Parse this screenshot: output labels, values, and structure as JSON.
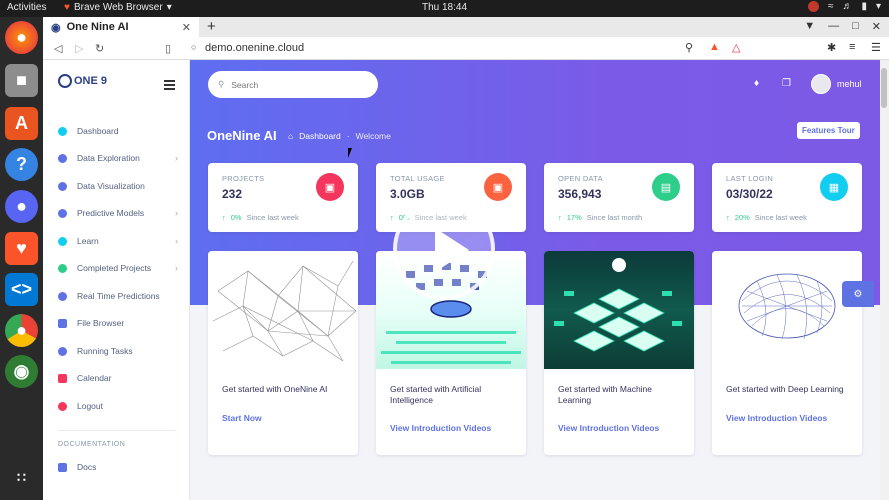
{
  "os": {
    "activities": "Activities",
    "app_name": "Brave Web Browser",
    "clock": "Thu 18:44"
  },
  "browser": {
    "tab_title": "One Nine AI",
    "url": "demo.onenine.cloud"
  },
  "logo": {
    "text": "ONE 9"
  },
  "sidebar": {
    "items": [
      {
        "label": "Dashboard",
        "color": "#11cdef",
        "chevron": false
      },
      {
        "label": "Data Exploration",
        "color": "#5e72e4",
        "chevron": true
      },
      {
        "label": "Data Visualization",
        "color": "#5e72e4",
        "chevron": false
      },
      {
        "label": "Predictive Models",
        "color": "#5e72e4",
        "chevron": true
      },
      {
        "label": "Learn",
        "color": "#11cdef",
        "chevron": true
      },
      {
        "label": "Completed Projects",
        "color": "#2dce89",
        "chevron": true
      },
      {
        "label": "Real Time Predictions",
        "color": "#5e72e4",
        "chevron": false
      },
      {
        "label": "File Browser",
        "color": "#5e72e4",
        "chevron": false
      },
      {
        "label": "Running Tasks",
        "color": "#5e72e4",
        "chevron": false
      },
      {
        "label": "Calendar",
        "color": "#f5365c",
        "chevron": false
      },
      {
        "label": "Logout",
        "color": "#f5365c",
        "chevron": false
      }
    ],
    "section_heading": "DOCUMENTATION",
    "docs_label": "Docs"
  },
  "header": {
    "search_placeholder": "Search",
    "user_name": "mehul"
  },
  "page": {
    "title": "OneNine AI",
    "breadcrumb": [
      "Dashboard",
      "Welcome"
    ],
    "tour_button": "Features Tour"
  },
  "stats": [
    {
      "label": "PROJECTS",
      "value": "232",
      "change": "0%",
      "period": "Since last week",
      "color": "#f5365c"
    },
    {
      "label": "TOTAL USAGE",
      "value": "3.0GB",
      "change": "0%",
      "period": "Since last week",
      "color": "#fb6340"
    },
    {
      "label": "OPEN DATA",
      "value": "356,943",
      "change": "17%",
      "period": "Since last month",
      "color": "#2dce89"
    },
    {
      "label": "LAST LOGIN",
      "value": "03/30/22",
      "change": "20%",
      "period": "Since last week",
      "color": "#11cdef"
    }
  ],
  "features": [
    {
      "title": "Get started with OneNine AI",
      "link": "Start Now"
    },
    {
      "title": "Get started with Artificial Intelligence",
      "link": "View Introduction Videos"
    },
    {
      "title": "Get started with Machine Learning",
      "link": "View Introduction Videos"
    },
    {
      "title": "Get started with Deep Learning",
      "link": "View Introduction Videos"
    }
  ]
}
